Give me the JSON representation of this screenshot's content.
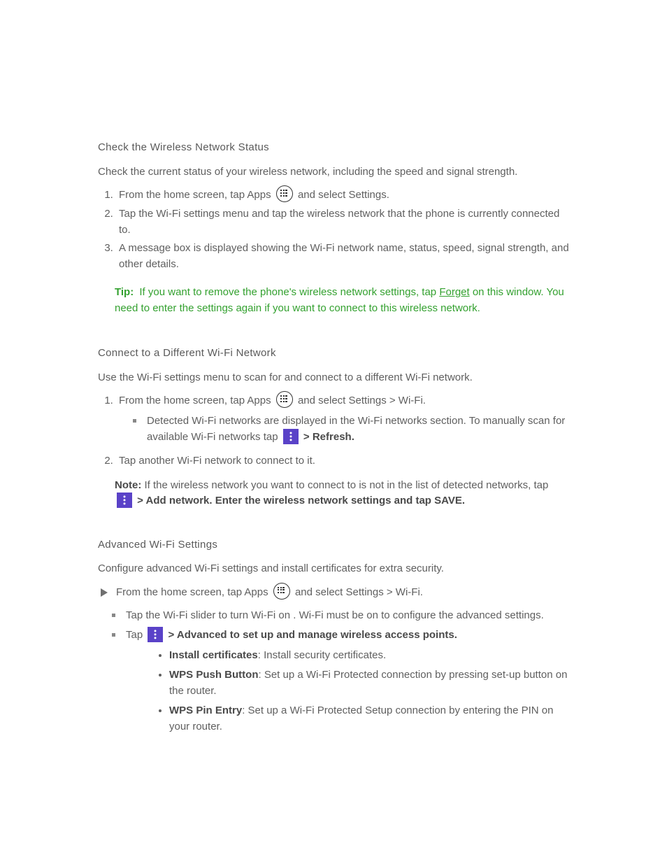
{
  "s1": {
    "heading": "Check the Wireless Network Status",
    "intro": "Check the current status of your wireless network, including the speed and signal strength.",
    "steps": {
      "a": {
        "prefix": "From the home screen, tap Apps",
        "suffix": "and select Settings."
      },
      "b": "Tap the Wi-Fi settings menu and tap the wireless network that the phone is currently connected to.",
      "c": "A message box is displayed showing the Wi-Fi network name, status, speed, signal strength, and other details."
    },
    "tip": {
      "label": "Tip:",
      "text": "If you want to remove the phone's wireless network settings, tap",
      "linklabel": "Forget",
      "after1": "on this window. You need to enter the settings again if you want to connect to this wireless",
      "after2": "network."
    }
  },
  "s2": {
    "heading": "Connect to a Different Wi-Fi Network",
    "intro": "Use the Wi-Fi settings menu to scan for and connect to a different Wi-Fi network.",
    "steps": {
      "a": {
        "prefix": "From the home screen, tap Apps",
        "suffix": "and select Settings > Wi-Fi."
      },
      "b1_text": "Detected Wi-Fi networks are displayed in the Wi-Fi networks section. To manually scan for",
      "b1_text2": "available Wi-Fi networks tap",
      "b1_suffix": "> Refresh.",
      "c": "Tap another Wi-Fi network to connect to it."
    },
    "note": {
      "label": "Note:",
      "text_before": "If the wireless network you want to connect to is not in the list of detected networks, tap",
      "text_suffix": "> Add network. Enter the wireless network settings and tap SAVE."
    }
  },
  "s3": {
    "heading": "Advanced Wi-Fi Settings",
    "intro": "Configure advanced Wi-Fi settings and install certificates for extra security.",
    "lead": {
      "prefix": "From the home screen, tap Apps",
      "suffix": "and select Settings > Wi-Fi."
    },
    "itemA": {
      "text_before": "Tap the Wi-Fi slider to turn Wi-Fi on ",
      "slider_on": "",
      "text_after": ". Wi-Fi must be on to configure the advanced settings."
    },
    "itemB": {
      "prefix": "Tap",
      "suffix": "> Advanced to set up and manage wireless access points.",
      "sub": {
        "a_strong": "Install certificates",
        "a_rest": ": Install security certificates.",
        "b_strong": "WPS Push Button",
        "b_rest": ": Set up a Wi-Fi Protected connection by pressing set-up button on the router.",
        "c_strong": "WPS Pin Entry",
        "c_rest": ": Set up a Wi-Fi Protected Setup connection by entering the PIN on your router."
      }
    }
  }
}
